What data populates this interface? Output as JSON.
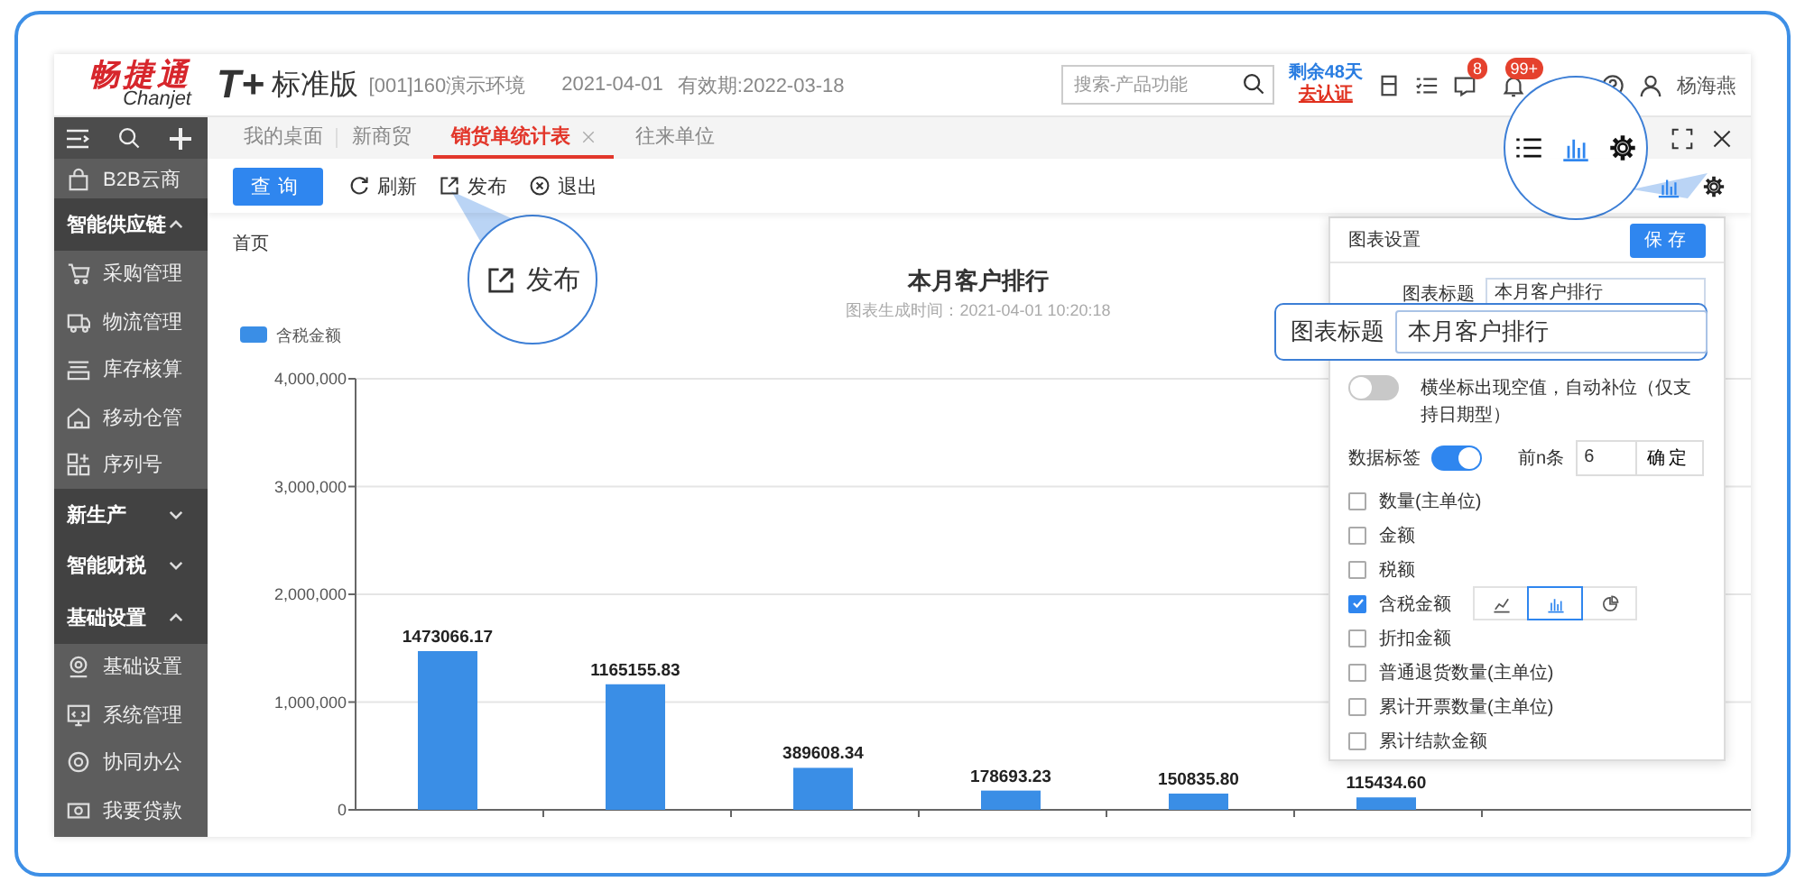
{
  "header": {
    "brand": "畅捷通",
    "brand_subtitle": "Chanjet",
    "product": "T+",
    "edition": "标准版",
    "environment": "[001]160演示环境",
    "date": "2021-04-01",
    "validity": "有效期:2022-03-18",
    "search": {
      "placeholder": "搜索-产品功能"
    },
    "trial_days": "剩余48天",
    "verify_link": "去认证",
    "message_badge": "8",
    "notification_badge": "99+",
    "user": "杨海燕"
  },
  "sidebar": {
    "items": [
      {
        "kind": "item",
        "label": "B2B云商"
      },
      {
        "kind": "group",
        "label": "智能供应链",
        "expanded": true,
        "children": [
          {
            "kind": "item",
            "label": "采购管理"
          },
          {
            "kind": "item",
            "label": "物流管理"
          },
          {
            "kind": "item",
            "label": "库存核算"
          },
          {
            "kind": "item",
            "label": "移动仓管"
          },
          {
            "kind": "item",
            "label": "序列号"
          }
        ]
      },
      {
        "kind": "group",
        "label": "新生产",
        "expanded": false
      },
      {
        "kind": "group",
        "label": "智能财税",
        "expanded": false
      },
      {
        "kind": "group",
        "label": "基础设置",
        "expanded": true,
        "children": [
          {
            "kind": "item",
            "label": "基础设置"
          },
          {
            "kind": "item",
            "label": "系统管理"
          },
          {
            "kind": "item",
            "label": "协同办公"
          },
          {
            "kind": "item",
            "label": "我要贷款"
          }
        ]
      }
    ]
  },
  "tabs": [
    {
      "label": "我的桌面",
      "selected": false,
      "closable": false
    },
    {
      "label": "新商贸",
      "selected": false,
      "closable": false
    },
    {
      "label": "销货单统计表",
      "selected": true,
      "closable": true
    },
    {
      "label": "往来单位",
      "selected": false,
      "closable": false
    }
  ],
  "toolbar": {
    "buttons": [
      {
        "label": "查询",
        "kind": "primary"
      },
      {
        "label": "刷新",
        "kind": "refresh"
      },
      {
        "label": "发布",
        "kind": "publish"
      },
      {
        "label": "退出",
        "kind": "exit"
      }
    ]
  },
  "breadcrumb": "首页",
  "chart": {
    "generated_at": "图表生成时间：2021-04-01 10:20:18",
    "chart_data": {
      "type": "bar",
      "title": "本月客户排行",
      "series": [
        {
          "name": "含税金额",
          "color": "#3a8ee6",
          "values": [
            1473066.17,
            1165155.83,
            389608.34,
            178693.23,
            150835.8,
            115434.6
          ]
        }
      ],
      "grid": true,
      "ylim": [
        0,
        4000000
      ],
      "yticks": [
        {
          "value": 0,
          "label": "0"
        },
        {
          "value": 1000000,
          "label": "1,000,000"
        },
        {
          "value": 2000000,
          "label": "2,000,000"
        },
        {
          "value": 3000000,
          "label": "3,000,000"
        },
        {
          "value": 4000000,
          "label": "4,000,000"
        }
      ],
      "value_labels": [
        "1473066.17",
        "1165155.83",
        "389608.34",
        "178693.23",
        "150835.80",
        "115434.60"
      ]
    }
  },
  "chart_settings": {
    "title": "图表设置",
    "save": "保存",
    "title_label": "图表标题",
    "title_value": "本月客户排行",
    "fill_gaps": {
      "label": "横坐标出现空值，自动补位（仅支持日期型）",
      "on": false
    },
    "data_labels": {
      "label": "数据标签",
      "on": true
    },
    "top_n": {
      "label": "前n条",
      "value": "6",
      "confirm": "确定"
    },
    "fields": [
      {
        "label": "数量(主单位)",
        "checked": false
      },
      {
        "label": "金额",
        "checked": false
      },
      {
        "label": "税额",
        "checked": false
      },
      {
        "label": "含税金额",
        "checked": true,
        "chart_types": [
          {
            "kind": "line",
            "selected": false
          },
          {
            "kind": "bar",
            "selected": true
          },
          {
            "kind": "pie",
            "selected": false
          }
        ]
      },
      {
        "label": "折扣金额",
        "checked": false
      },
      {
        "label": "普通退货数量(主单位)",
        "checked": false
      },
      {
        "label": "累计开票数量(主单位)",
        "checked": false
      },
      {
        "label": "累计结款金额",
        "checked": false
      }
    ]
  },
  "callouts": {
    "publish": "发布",
    "title_label": "图表标题",
    "title_value": "本月客户排行"
  }
}
